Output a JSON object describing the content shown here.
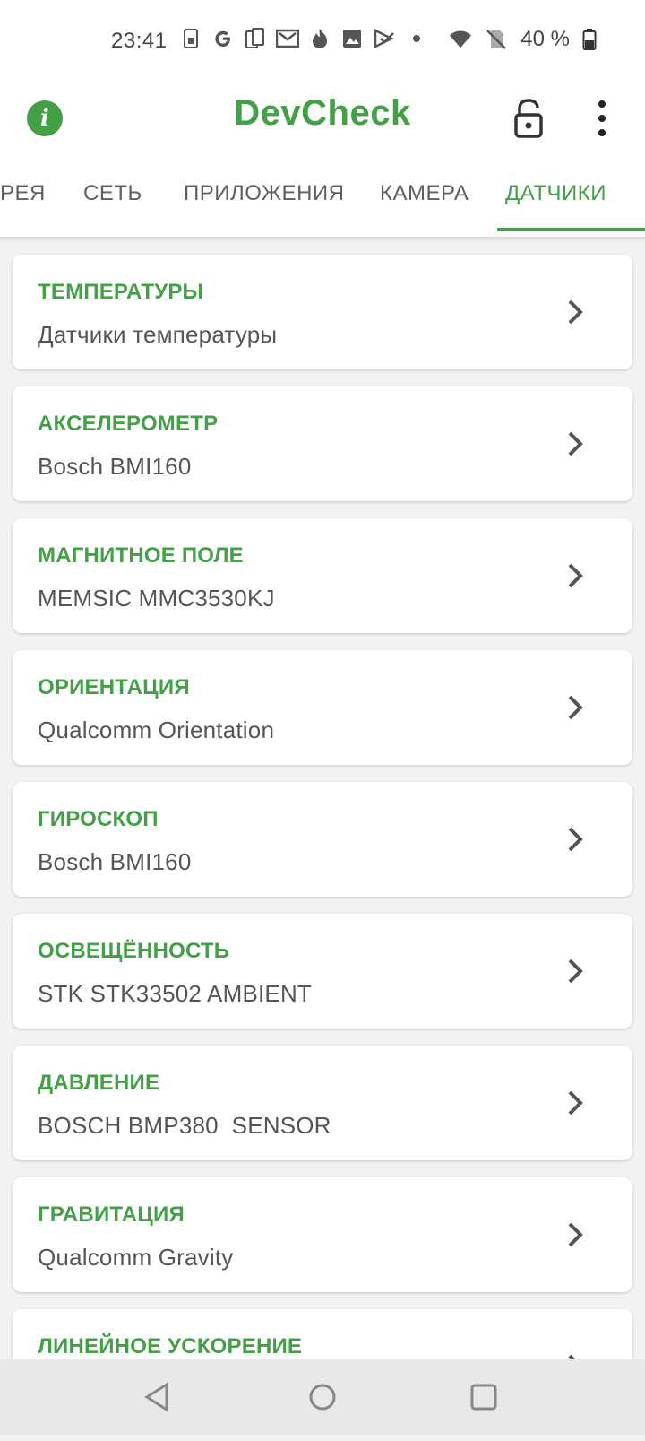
{
  "status_bar": {
    "time": "23:41",
    "battery": "40 %",
    "icons": [
      "sim-icon",
      "google-icon",
      "copy-icon",
      "gmail-icon",
      "fire-icon",
      "image-icon",
      "play-icon",
      "dot-icon",
      "wifi-icon",
      "no-sim-icon",
      "battery-icon"
    ]
  },
  "app_bar": {
    "title": "DevCheck",
    "info_icon": "info-icon",
    "lock_icon": "lock-icon",
    "more_icon": "more-vert-icon"
  },
  "tabs": {
    "items": [
      {
        "label": "РЕЯ"
      },
      {
        "label": "СЕТЬ"
      },
      {
        "label": "ПРИЛОЖЕНИЯ"
      },
      {
        "label": "КАМЕРА"
      },
      {
        "label": "ДАТЧИКИ"
      }
    ],
    "active": "ДАТЧИКИ"
  },
  "sensors": [
    {
      "title": "ТЕМПЕРАТУРЫ",
      "subtitle": "Датчики температуры"
    },
    {
      "title": "АКСЕЛЕРОМЕТР",
      "subtitle": "Bosch BMI160"
    },
    {
      "title": "МАГНИТНОЕ ПОЛЕ",
      "subtitle": "MEMSIC MMC3530KJ"
    },
    {
      "title": "ОРИЕНТАЦИЯ",
      "subtitle": "Qualcomm Orientation"
    },
    {
      "title": "ГИРОСКОП",
      "subtitle": "Bosch BMI160"
    },
    {
      "title": "ОСВЕЩЁННОСТЬ",
      "subtitle": "STK STK33502 AMBIENT"
    },
    {
      "title": "ДАВЛЕНИЕ",
      "subtitle": "BOSCH BMP380  SENSOR"
    },
    {
      "title": "ГРАВИТАЦИЯ",
      "subtitle": "Qualcomm Gravity"
    },
    {
      "title": "ЛИНЕЙНОЕ УСКОРЕНИЕ",
      "subtitle": ""
    }
  ],
  "nav": {
    "back_icon": "back-icon",
    "home_icon": "home-icon",
    "recents_icon": "recents-icon"
  },
  "colors": {
    "accent": "#43a047",
    "text_secondary": "#555555",
    "background": "#f2f2f2"
  }
}
